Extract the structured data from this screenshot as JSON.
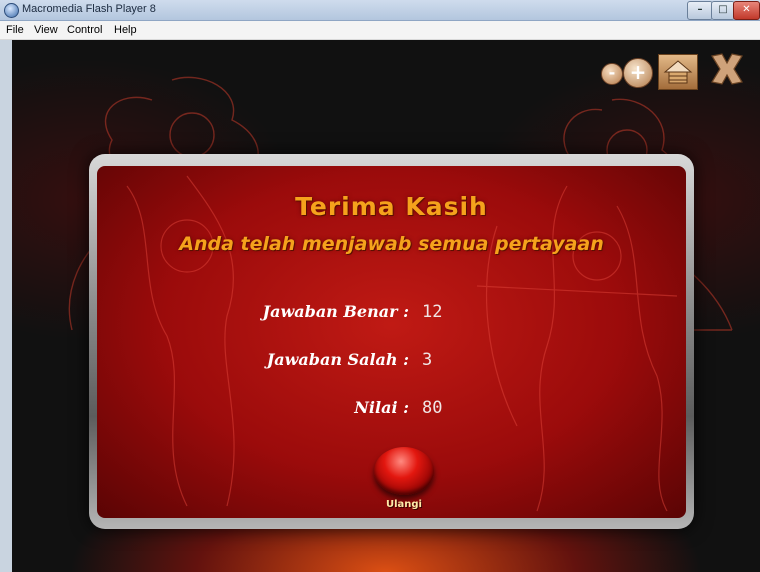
{
  "window": {
    "title": "Macromedia Flash Player 8",
    "controls": {
      "minimize": "–",
      "maximize": "□",
      "close": "✕"
    }
  },
  "menu": {
    "items": [
      "File",
      "View",
      "Control",
      "Help"
    ]
  },
  "toolbar": {
    "zoom_out": "-",
    "zoom_in": "+",
    "home_icon": "home-icon",
    "exit_icon": "close-icon"
  },
  "result": {
    "title": "Terima Kasih",
    "subtitle": "Anda telah menjawab semua pertayaan",
    "rows": [
      {
        "label": "Jawaban Benar :",
        "value": "12"
      },
      {
        "label": "Jawaban Salah :",
        "value": "3"
      },
      {
        "label": "Nilai :",
        "value": "80"
      }
    ],
    "retry_label": "Ulangi"
  },
  "colors": {
    "title_orange": "#f5a21c",
    "panel_red": "#c01a14",
    "background": "#111111"
  }
}
